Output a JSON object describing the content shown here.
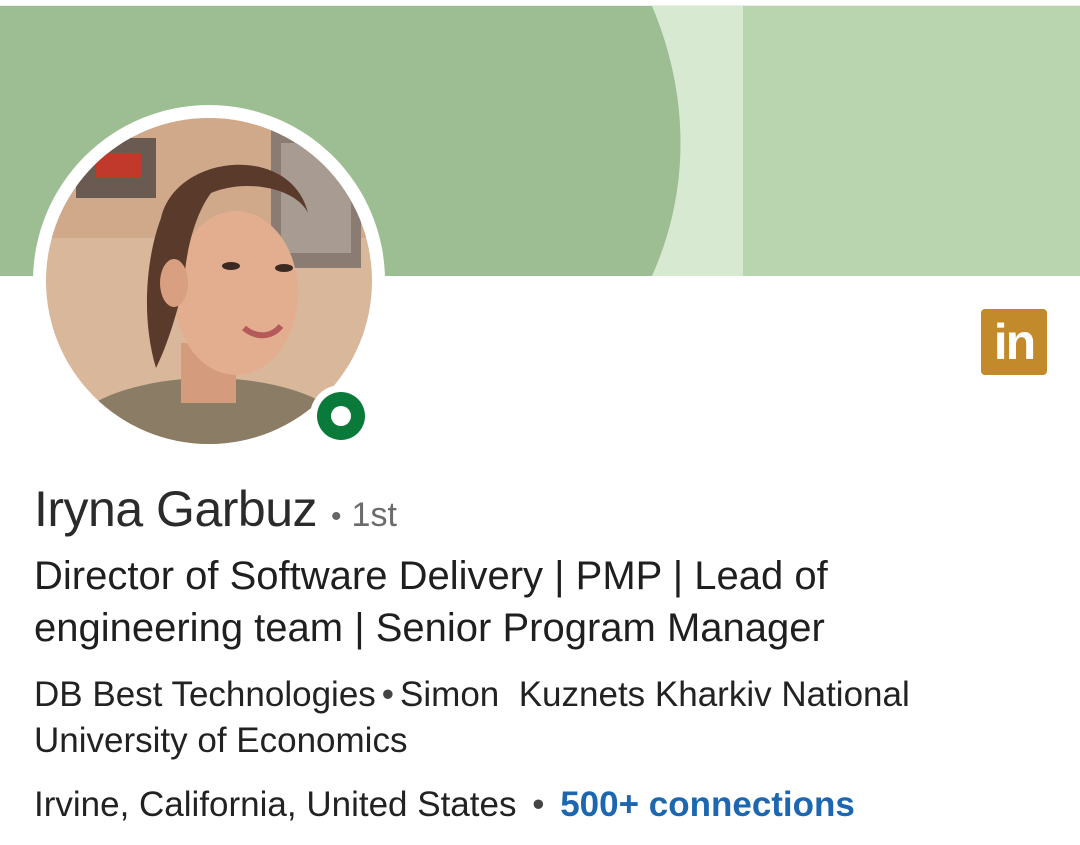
{
  "profile": {
    "name": "Iryna Garbuz",
    "degree": "1st",
    "headline": "Director of Software Delivery | PMP | Lead of engineering team | Senior Program Manager",
    "company": "DB Best Technologies",
    "education": "Simon  Kuznets Kharkiv National University of Economics",
    "location": "Irvine, California, United States",
    "connections": "500+ connections",
    "separator": "•"
  },
  "badge": {
    "text": "in",
    "icon": "linkedin-icon"
  },
  "presence": {
    "status": "online",
    "icon": "online-status-icon"
  },
  "colors": {
    "banner_dark": "#9dbd93",
    "banner_light": "#b8d5b0",
    "banner_stripe": "#d7ead1",
    "presence_green": "#0a7a3b",
    "link_blue": "#1c67b0",
    "badge_gold": "#c28a2a"
  }
}
